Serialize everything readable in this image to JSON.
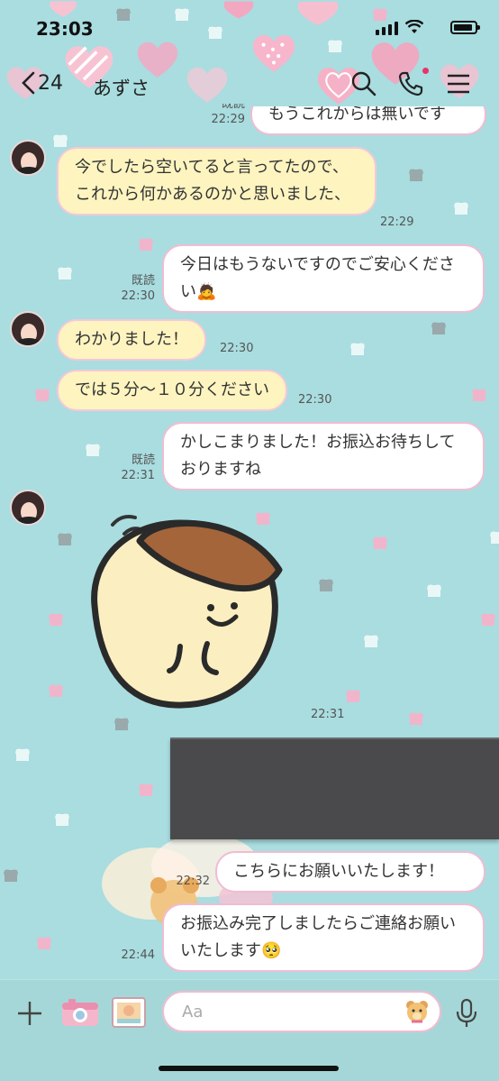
{
  "status_bar": {
    "time": "23:03"
  },
  "header": {
    "back_count": "24",
    "chat_name": "あずさ"
  },
  "messages": [
    {
      "side": "out",
      "text": "もうこれからは無いです",
      "read": "既読",
      "time": "22:29"
    },
    {
      "side": "in",
      "text": "今でしたら空いてると言ってたので、これから何かあるのかと思いました、",
      "time": "22:29"
    },
    {
      "side": "out",
      "text": "今日はもうないですのでご安心ください🙇",
      "read": "既読",
      "time": "22:30"
    },
    {
      "side": "in",
      "text": "わかりました！",
      "time": "22:30"
    },
    {
      "side": "in",
      "text": "では５分〜１０分ください",
      "time": "22:30"
    },
    {
      "side": "out",
      "text": "かしこまりました！お振込お待ちしておりますね",
      "read": "既読",
      "time": "22:31"
    },
    {
      "side": "in",
      "type": "sticker",
      "time": "22:31"
    },
    {
      "side": "out",
      "type": "image",
      "text": "[redacted]"
    },
    {
      "side": "out",
      "text": "こちらにお願いいたします！",
      "time": "22:32"
    },
    {
      "side": "out",
      "text": "お振込み完了しましたらご連絡お願いいたします🥺",
      "time": "22:44"
    }
  ],
  "input": {
    "placeholder": "Aa"
  },
  "colors": {
    "wallpaper": "#a9dde0",
    "incoming_bubble": "#fdf4c0",
    "outgoing_bubble": "#ffffff",
    "bubble_border": "#f0bcd2"
  },
  "icons": [
    "back-chevron-icon",
    "search-icon",
    "phone-icon",
    "menu-icon",
    "plus-icon",
    "camera-icon",
    "album-icon",
    "bear-sticker-icon",
    "mic-icon"
  ]
}
